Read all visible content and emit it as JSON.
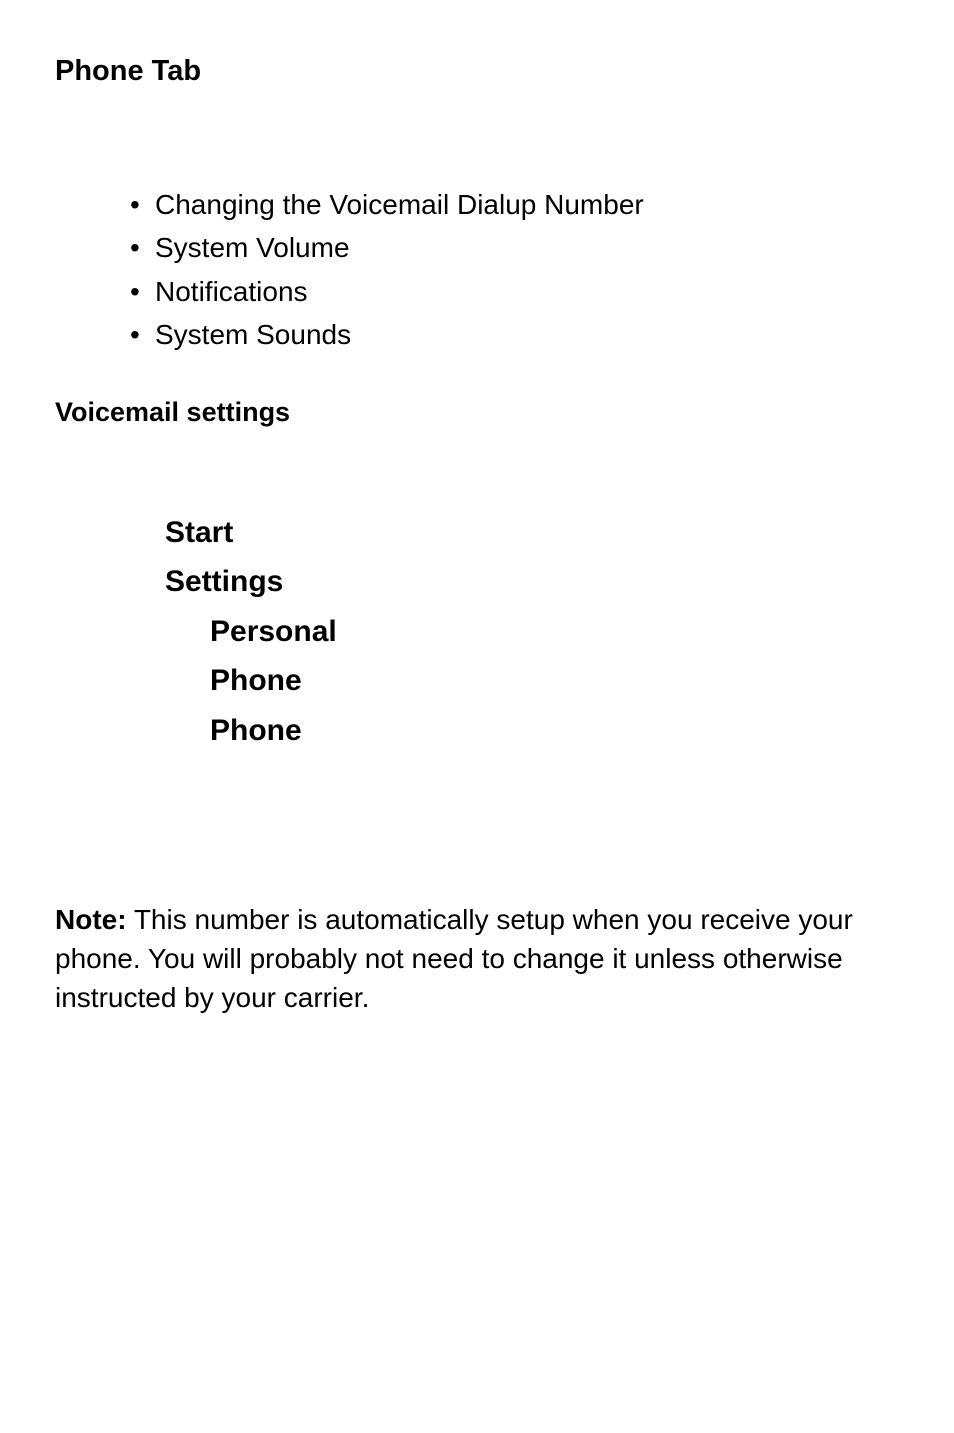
{
  "heading": "Phone Tab",
  "bullets": [
    "Changing the Voicemail Dialup Number",
    "System Volume",
    "Notifications",
    "System Sounds"
  ],
  "subheading": "Voicemail settings",
  "nav": {
    "items": [
      {
        "label": "Start",
        "indent": 0
      },
      {
        "label": "Settings",
        "indent": 0
      },
      {
        "label": "Personal",
        "indent": 1
      },
      {
        "label": "Phone",
        "indent": 1
      },
      {
        "label": "Phone",
        "indent": 1
      }
    ]
  },
  "note": {
    "label": "Note:",
    "text": " This number is automatically setup when you receive your phone. You will probably not need to change it unless otherwise instructed by your carrier."
  }
}
